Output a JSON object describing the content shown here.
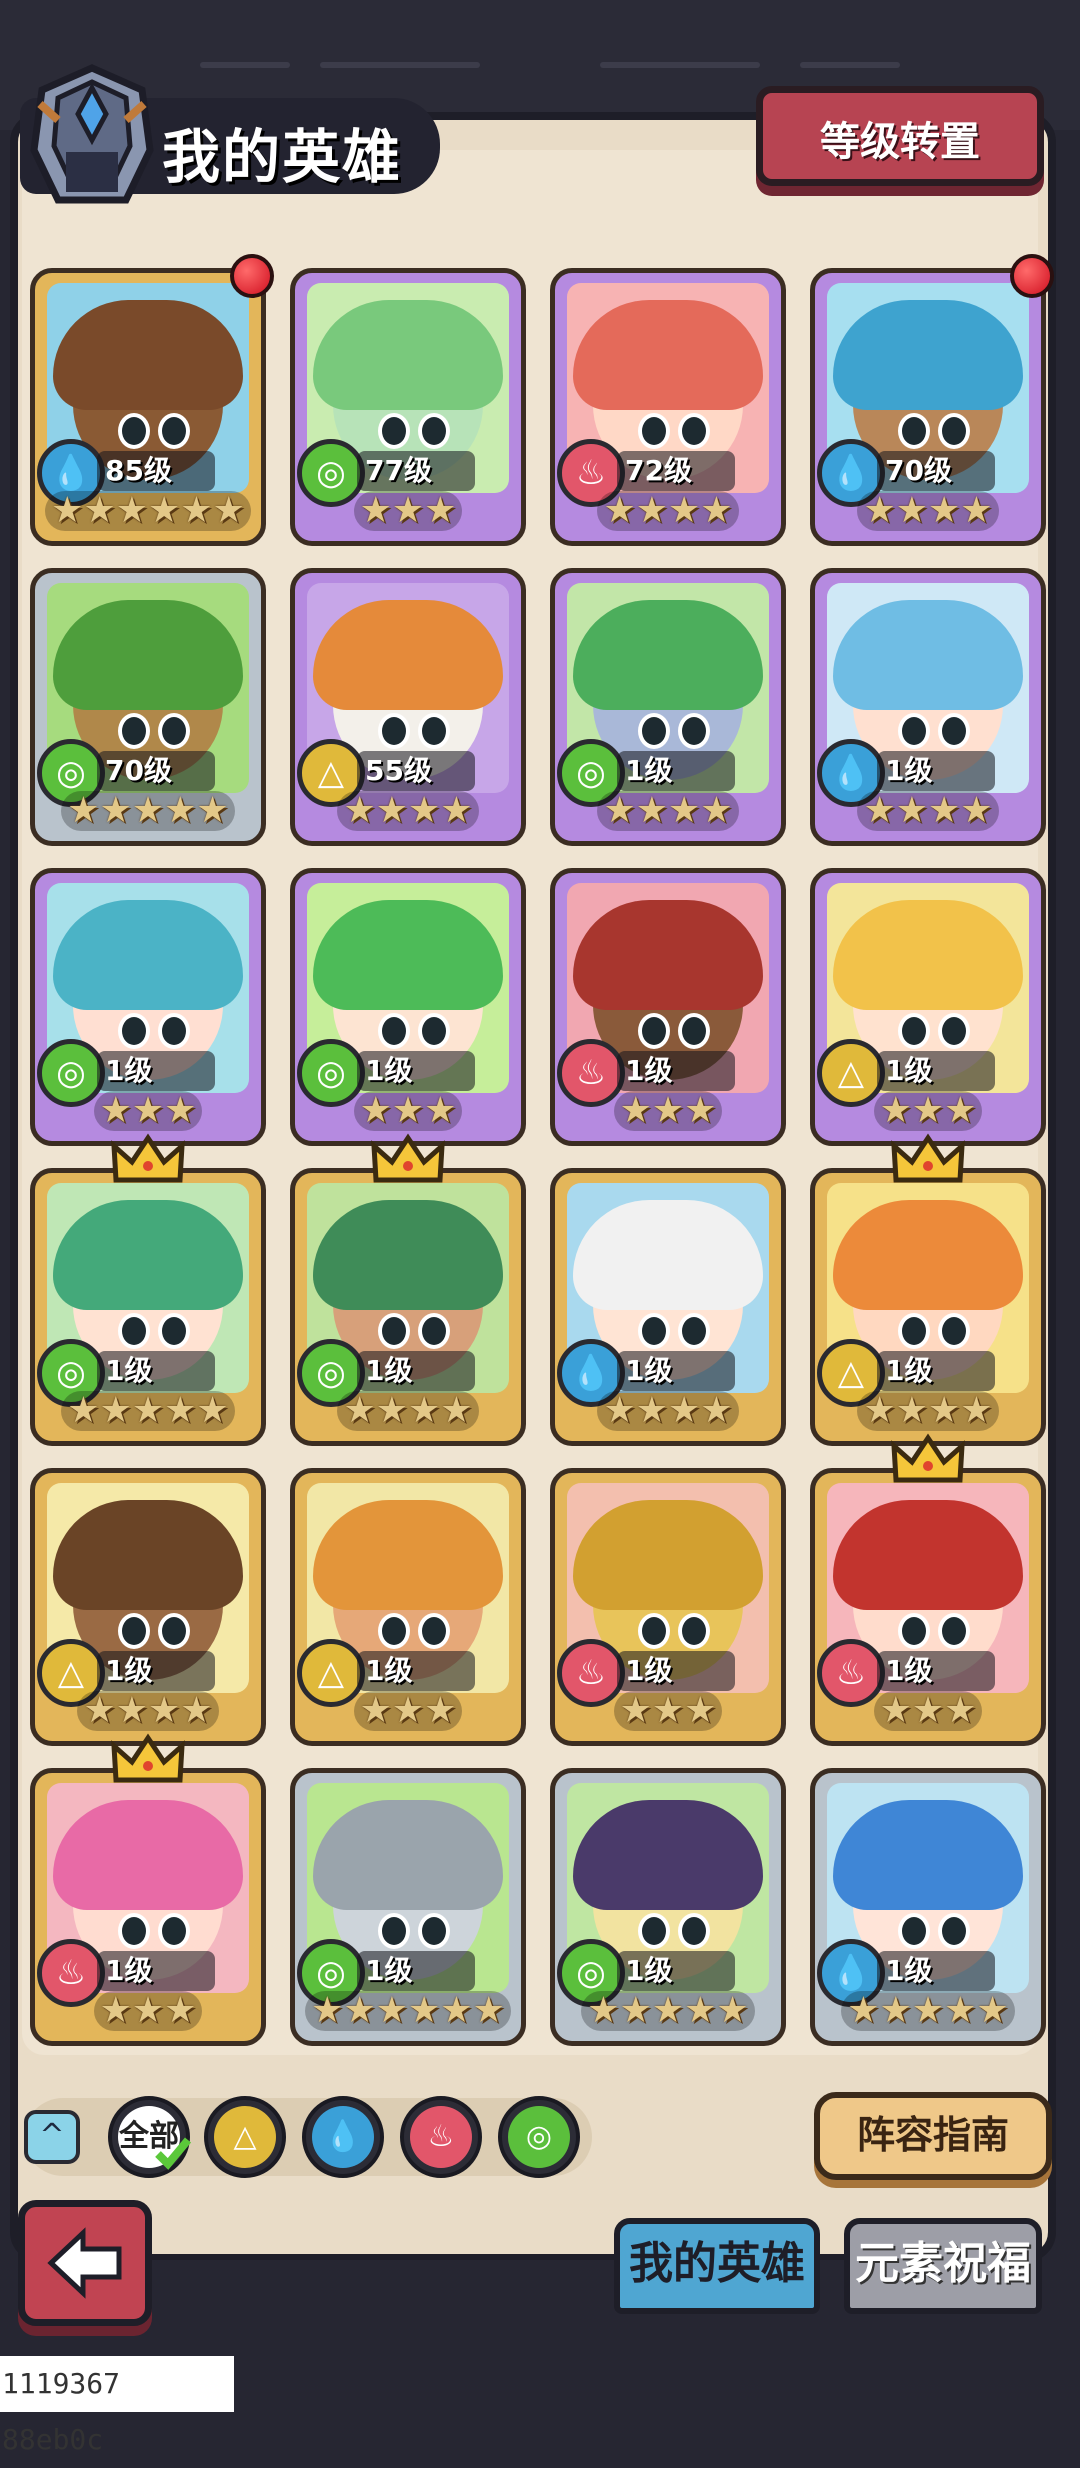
{
  "header": {
    "title": "我的英雄",
    "level_reset_button": "等级转置"
  },
  "colors": {
    "water": "#3aa0d8",
    "wind": "#5bbf3c",
    "fire": "#e2566a",
    "earth": "#e0b93a",
    "frame_gold": "#e3b65a",
    "frame_purple": "#b58ae0",
    "frame_silver": "#b9c3cc"
  },
  "heroes": [
    {
      "level": "85级",
      "element": "water",
      "stars": 6,
      "frame": "gold",
      "bg": "#8fd1e8",
      "hair": "#7a4a2a",
      "skin": "#8a5a34",
      "red_dot": true,
      "crown": false
    },
    {
      "level": "77级",
      "element": "wind",
      "stars": 3,
      "frame": "purple",
      "bg": "#c9ecb0",
      "hair": "#79c97c",
      "skin": "#b7e3b8",
      "red_dot": false,
      "crown": false
    },
    {
      "level": "72级",
      "element": "fire",
      "stars": 4,
      "frame": "purple",
      "bg": "#f7b3b3",
      "hair": "#e46a5a",
      "skin": "#ffd8c6",
      "red_dot": false,
      "crown": false
    },
    {
      "level": "70级",
      "element": "water",
      "stars": 4,
      "frame": "purple",
      "bg": "#a7dff0",
      "hair": "#3ea3cf",
      "skin": "#b98759",
      "red_dot": true,
      "crown": false
    },
    {
      "level": "70级",
      "element": "wind",
      "stars": 5,
      "frame": "silver",
      "bg": "#a6db7e",
      "hair": "#4e9e3c",
      "skin": "#b0884a",
      "red_dot": false,
      "crown": false
    },
    {
      "level": "55级",
      "element": "earth",
      "stars": 4,
      "frame": "purple",
      "bg": "#c7a6e8",
      "hair": "#e58a3a",
      "skin": "#f3f0ea",
      "red_dot": false,
      "crown": false
    },
    {
      "level": "1级",
      "element": "wind",
      "stars": 4,
      "frame": "purple",
      "bg": "#c2e6a8",
      "hair": "#4cae5c",
      "skin": "#a9b8d8",
      "red_dot": false,
      "crown": false
    },
    {
      "level": "1级",
      "element": "water",
      "stars": 4,
      "frame": "purple",
      "bg": "#cfe8f6",
      "hair": "#6fbde4",
      "skin": "#ffe0d0",
      "red_dot": false,
      "crown": false
    },
    {
      "level": "1级",
      "element": "wind",
      "stars": 3,
      "frame": "purple",
      "bg": "#a7e0ea",
      "hair": "#4bb3c6",
      "skin": "#ffdfd2",
      "red_dot": false,
      "crown": false
    },
    {
      "level": "1级",
      "element": "wind",
      "stars": 3,
      "frame": "purple",
      "bg": "#c6ee9a",
      "hair": "#4dbb58",
      "skin": "#fde4d2",
      "red_dot": false,
      "crown": false
    },
    {
      "level": "1级",
      "element": "fire",
      "stars": 3,
      "frame": "purple",
      "bg": "#f1a7b1",
      "hair": "#a8362e",
      "skin": "#8a5a3a",
      "red_dot": false,
      "crown": false
    },
    {
      "level": "1级",
      "element": "earth",
      "stars": 3,
      "frame": "purple",
      "bg": "#f3e59a",
      "hair": "#f2c24a",
      "skin": "#ffe2cf",
      "red_dot": false,
      "crown": false
    },
    {
      "level": "1级",
      "element": "wind",
      "stars": 5,
      "frame": "gold",
      "bg": "#bfe7b5",
      "hair": "#44a97a",
      "skin": "#ffe2d2",
      "red_dot": false,
      "crown": true
    },
    {
      "level": "1级",
      "element": "wind",
      "stars": 4,
      "frame": "gold",
      "bg": "#bfe29c",
      "hair": "#3f8c58",
      "skin": "#d7a07a",
      "red_dot": false,
      "crown": true
    },
    {
      "level": "1级",
      "element": "water",
      "stars": 4,
      "frame": "gold",
      "bg": "#a9d9ee",
      "hair": "#f1f1f1",
      "skin": "#ffe4d4",
      "red_dot": false,
      "crown": false
    },
    {
      "level": "1级",
      "element": "earth",
      "stars": 4,
      "frame": "gold",
      "bg": "#f6e189",
      "hair": "#ec8a3a",
      "skin": "#ffd8c0",
      "red_dot": false,
      "crown": true
    },
    {
      "level": "1级",
      "element": "earth",
      "stars": 4,
      "frame": "gold",
      "bg": "#f5e9a8",
      "hair": "#6a4426",
      "skin": "#9a6a44",
      "red_dot": false,
      "crown": false
    },
    {
      "level": "1级",
      "element": "earth",
      "stars": 3,
      "frame": "gold",
      "bg": "#f2e7a6",
      "hair": "#e3953a",
      "skin": "#e6a878",
      "red_dot": false,
      "crown": false
    },
    {
      "level": "1级",
      "element": "fire",
      "stars": 3,
      "frame": "gold",
      "bg": "#f3bfae",
      "hair": "#d2a030",
      "skin": "#e8c45a",
      "red_dot": false,
      "crown": false
    },
    {
      "level": "1级",
      "element": "fire",
      "stars": 3,
      "frame": "gold",
      "bg": "#f6b6bb",
      "hair": "#c2342e",
      "skin": "#ffdccc",
      "red_dot": false,
      "crown": true
    },
    {
      "level": "1级",
      "element": "fire",
      "stars": 3,
      "frame": "gold",
      "bg": "#f4b7c0",
      "hair": "#e86aa6",
      "skin": "#ffdcd0",
      "red_dot": false,
      "crown": true
    },
    {
      "level": "1级",
      "element": "wind",
      "stars": 6,
      "frame": "silver",
      "bg": "#b9e690",
      "hair": "#9aa4ac",
      "skin": "#cdd4da",
      "red_dot": false,
      "crown": false
    },
    {
      "level": "1级",
      "element": "wind",
      "stars": 5,
      "frame": "silver",
      "bg": "#bfe6a2",
      "hair": "#4a3a6a",
      "skin": "#f2e3a0",
      "red_dot": false,
      "crown": false
    },
    {
      "level": "1级",
      "element": "water",
      "stars": 5,
      "frame": "silver",
      "bg": "#bde3f2",
      "hair": "#3f86d6",
      "skin": "#ffe4d8",
      "red_dot": false,
      "crown": false
    }
  ],
  "filters": {
    "all_label": "全部",
    "elements": [
      "earth",
      "water",
      "fire",
      "wind"
    ]
  },
  "lineup_guide_button": "阵容指南",
  "tabs": [
    {
      "label": "我的英雄",
      "active": true
    },
    {
      "label": "元素祝福",
      "active": false
    }
  ],
  "footer_id": "1119367 88eb0c"
}
